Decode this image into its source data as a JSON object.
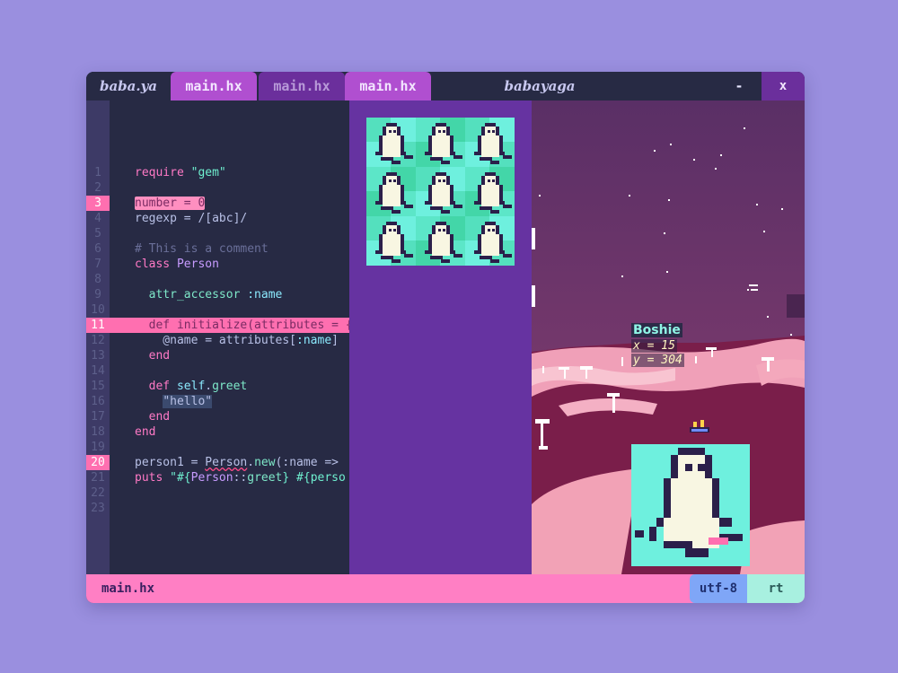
{
  "titlebar": {
    "app_name": "baba.ya",
    "tabs": [
      {
        "label": "main.hx"
      },
      {
        "label": "main.hx"
      },
      {
        "label": "main.hx"
      }
    ],
    "window_title": "babayaga",
    "minimize_label": "-",
    "close_label": "x"
  },
  "editor": {
    "line_numbers": [
      "1",
      "2",
      "3",
      "4",
      "5",
      "6",
      "7",
      "8",
      "9",
      "10",
      "11",
      "12",
      "13",
      "14",
      "15",
      "16",
      "17",
      "18",
      "19",
      "20",
      "21",
      "22",
      "23"
    ],
    "highlighted_lines": [
      3,
      11,
      20
    ],
    "lines": [
      {
        "tokens": [
          {
            "t": "require ",
            "c": "kw"
          },
          {
            "t": "\"gem\"",
            "c": "str"
          }
        ]
      },
      {
        "tokens": []
      },
      {
        "tokens": [
          {
            "t": "number = 0",
            "c": "sel-box"
          }
        ]
      },
      {
        "tokens": [
          {
            "t": "regexp = /[abc]/",
            "c": "plain"
          }
        ]
      },
      {
        "tokens": []
      },
      {
        "tokens": [
          {
            "t": "# This is a comment",
            "c": "cmt"
          }
        ]
      },
      {
        "tokens": [
          {
            "t": "class ",
            "c": "kw"
          },
          {
            "t": "Person",
            "c": "cls"
          }
        ]
      },
      {
        "tokens": []
      },
      {
        "tokens": [
          {
            "t": "  attr_accessor ",
            "c": "fn"
          },
          {
            "t": ":name",
            "c": "sym"
          }
        ]
      },
      {
        "tokens": []
      },
      {
        "tokens": [
          {
            "t": "  def initialize(attributes = {})",
            "c": "kw-hl"
          }
        ]
      },
      {
        "tokens": [
          {
            "t": "    @name = attributes[",
            "c": "plain"
          },
          {
            "t": ":name",
            "c": "sym"
          },
          {
            "t": "]",
            "c": "plain"
          }
        ]
      },
      {
        "tokens": [
          {
            "t": "  end",
            "c": "kw"
          }
        ]
      },
      {
        "tokens": []
      },
      {
        "tokens": [
          {
            "t": "  def ",
            "c": "kw"
          },
          {
            "t": "self",
            "c": "sym"
          },
          {
            "t": ".",
            "c": "plain"
          },
          {
            "t": "greet",
            "c": "fn"
          }
        ]
      },
      {
        "tokens": [
          {
            "t": "    ",
            "c": "plain"
          },
          {
            "t": "\"hello\"",
            "c": "str-bg"
          }
        ]
      },
      {
        "tokens": [
          {
            "t": "  end",
            "c": "kw"
          }
        ]
      },
      {
        "tokens": [
          {
            "t": "end",
            "c": "kw"
          }
        ]
      },
      {
        "tokens": []
      },
      {
        "tokens": [
          {
            "t": "person1 = ",
            "c": "plain"
          },
          {
            "t": "Person",
            "c": "squiggle"
          },
          {
            "t": ".",
            "c": "plain"
          },
          {
            "t": "new",
            "c": "fn"
          },
          {
            "t": "(:name => ",
            "c": "plain"
          }
        ]
      },
      {
        "tokens": [
          {
            "t": "puts ",
            "c": "kw"
          },
          {
            "t": "\"#{",
            "c": "str"
          },
          {
            "t": "Person",
            "c": "cls"
          },
          {
            "t": "::",
            "c": "plain"
          },
          {
            "t": "greet",
            "c": "fn"
          },
          {
            "t": "} #{perso",
            "c": "str"
          }
        ]
      },
      {
        "tokens": []
      },
      {
        "tokens": []
      }
    ]
  },
  "game": {
    "character_name": "Boshie",
    "coord_x": "x = 15",
    "coord_y": "y = 304"
  },
  "statusbar": {
    "file": "main.hx",
    "encoding": "utf-8",
    "mode": "rt"
  },
  "colors": {
    "background": "#9a8fdf",
    "editor_bg": "#272a44",
    "panel_purple": "#6633a1",
    "tab_active": "#b04fd0",
    "statusbar_pink": "#ff7fc4",
    "highlight_pink": "#ff6fb0",
    "sprite_cyan": "#6ef0de",
    "sprite_green": "#43d6a8"
  }
}
